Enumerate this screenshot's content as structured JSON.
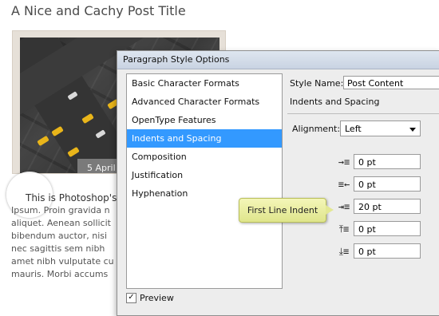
{
  "post": {
    "title": "A Nice and Cachy Post Title",
    "date_badge": "5 April",
    "body_lines": [
      "This is Photoshop's",
      "Ipsum. Proin gravida n",
      "aliquet. Aenean sollicit",
      "bibendum auctor, nisi",
      "nec sagittis sem nibh",
      "amet nibh vulputate cu",
      "mauris. Morbi accums"
    ]
  },
  "dialog": {
    "title": "Paragraph Style Options",
    "categories": [
      "Basic Character Formats",
      "Advanced Character Formats",
      "OpenType Features",
      "Indents and Spacing",
      "Composition",
      "Justification",
      "Hyphenation"
    ],
    "selected_category": "Indents and Spacing",
    "preview_label": "Preview",
    "preview_checked": true,
    "style_name_label": "Style Name:",
    "style_name_value": "Post Content",
    "section_title": "Indents and Spacing",
    "alignment_label": "Alignment:",
    "alignment_value": "Left",
    "fields": [
      {
        "icon": "left-indent-icon",
        "value": "0 pt"
      },
      {
        "icon": "right-indent-icon",
        "value": "0 pt"
      },
      {
        "icon": "first-line-indent-icon",
        "value": "20 pt"
      },
      {
        "icon": "space-before-icon",
        "value": "0 pt"
      },
      {
        "icon": "space-after-icon",
        "value": "0 pt"
      }
    ]
  },
  "callout": {
    "text": "First Line Indent"
  },
  "colors": {
    "selection": "#3399ff",
    "callout": "#e6ea9a"
  }
}
